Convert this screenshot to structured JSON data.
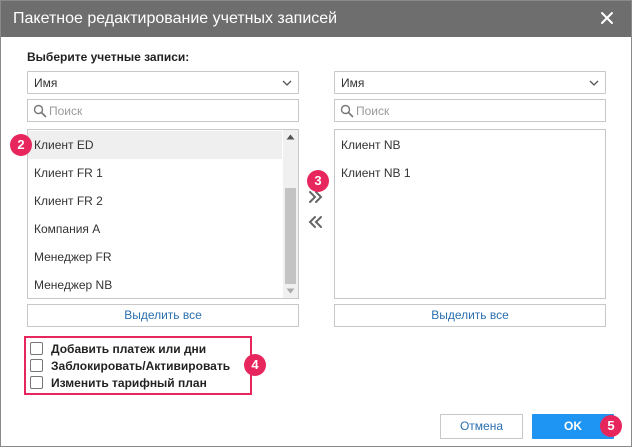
{
  "dialog": {
    "title": "Пакетное редактирование учетных записей",
    "section_label": "Выберите учетные записи:"
  },
  "left": {
    "sort_value": "Имя",
    "search_placeholder": "Поиск",
    "items": [
      {
        "label": "Клиент ED",
        "selected": true
      },
      {
        "label": "Клиент FR 1",
        "selected": false
      },
      {
        "label": "Клиент FR 2",
        "selected": false
      },
      {
        "label": "Компания А",
        "selected": false
      },
      {
        "label": "Менеджер FR",
        "selected": false
      },
      {
        "label": "Менеджер NB",
        "selected": false
      }
    ],
    "select_all_label": "Выделить все"
  },
  "right": {
    "sort_value": "Имя",
    "search_placeholder": "Поиск",
    "items": [
      {
        "label": "Клиент NB"
      },
      {
        "label": "Клиент NB 1"
      }
    ],
    "select_all_label": "Выделить все"
  },
  "options": [
    {
      "label": "Добавить платеж или дни",
      "checked": false
    },
    {
      "label": "Заблокировать/Активировать",
      "checked": false
    },
    {
      "label": "Изменить тарифный план",
      "checked": false
    }
  ],
  "badges": [
    "2",
    "3",
    "4",
    "5"
  ],
  "footer": {
    "cancel_label": "Отмена",
    "ok_label": "OK"
  },
  "colors": {
    "titlebar": "#6e6e6e",
    "accent": "#1e95f2",
    "badge": "#e8265e",
    "link": "#2a6fb0"
  }
}
